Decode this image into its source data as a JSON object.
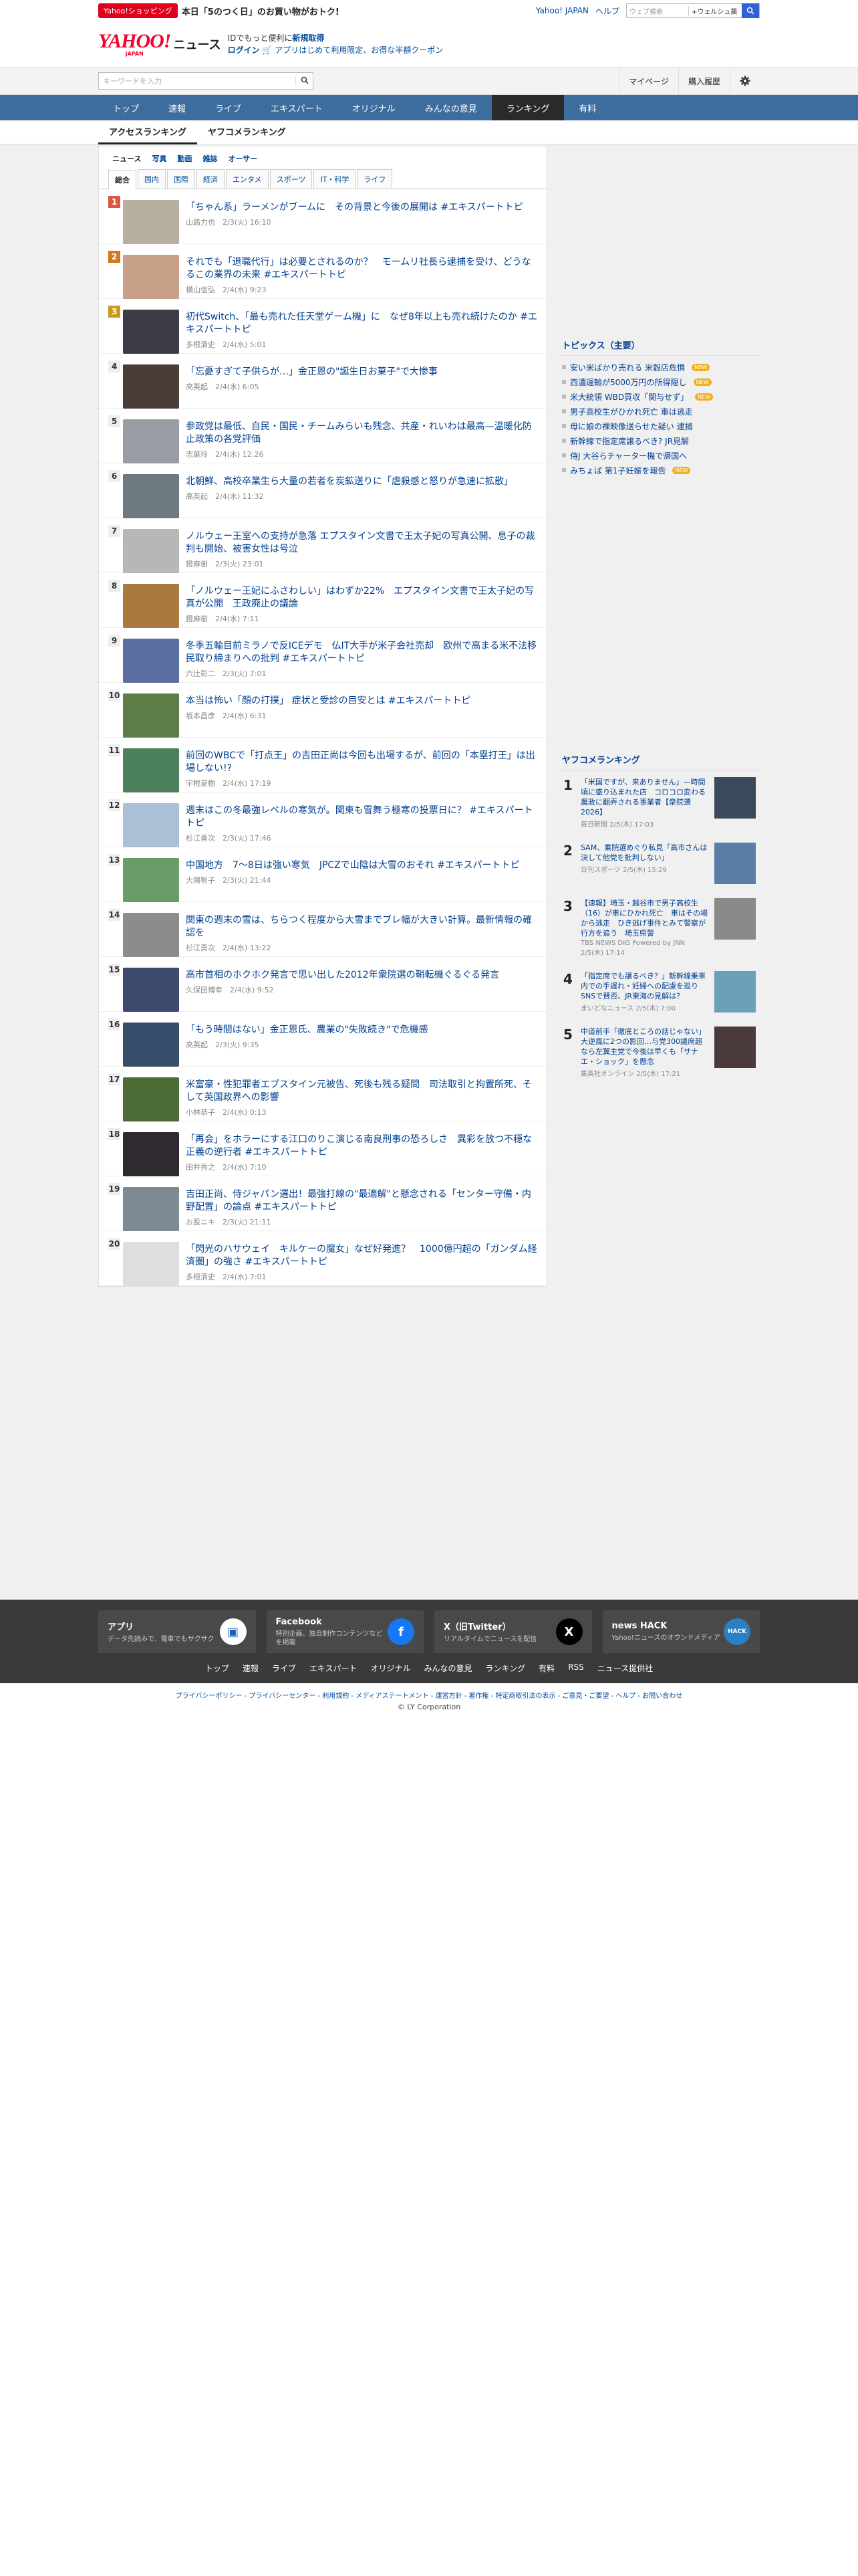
{
  "top": {
    "promo_badge": "Yahoo!ショッピング",
    "promo_text": "本日「5のつく日」のお買い物がおトク!",
    "links": [
      "Yahoo! JAPAN",
      "ヘルプ"
    ],
    "web_search_placeholder": "ウェブ検索",
    "web_search_option": "+ウェルシュ薬",
    "search_icon": "search-icon"
  },
  "header": {
    "logo_text": "YAHOO!",
    "logo_sub": "JAPAN",
    "logo_section": "ニュース",
    "line1_a": "IDでもっと便利に",
    "line1_b": "新規取得",
    "line2_a": "ログイン",
    "line2_b": "アプリはじめて利用限定、お得な半額クーポン"
  },
  "search": {
    "placeholder": "キーワードを入力",
    "mypage": "マイページ",
    "history": "購入履歴",
    "settings_icon": "gear-icon"
  },
  "nav": [
    "トップ",
    "速報",
    "ライブ",
    "エキスパート",
    "オリジナル",
    "みんなの意見",
    "ランキング",
    "有料"
  ],
  "nav_active": "ランキング",
  "subnav": [
    "アクセスランキング",
    "ヤフコメランキング"
  ],
  "categories": [
    "ニュース",
    "写真",
    "動画",
    "雑誌",
    "オーサー"
  ],
  "tabs": [
    "総合",
    "国内",
    "国際",
    "経済",
    "エンタメ",
    "スポーツ",
    "IT・科学",
    "ライフ"
  ],
  "ranking": [
    {
      "rank": "1",
      "title": "「ちゃん系」ラーメンがブームに　その背景と今後の展開は #エキスパートトピ",
      "meta": "山路力也　2/3(火) 16:10",
      "color": "#b7b0a0"
    },
    {
      "rank": "2",
      "title": "それでも「退職代行」は必要とされるのか？　モームリ社長ら逮捕を受け、どうなるこの業界の未来 #エキスパートトピ",
      "meta": "横山信弘　2/4(水) 9:23",
      "color": "#c8a08a"
    },
    {
      "rank": "3",
      "title": "初代Switch、「最も売れた任天堂ゲーム機」に　なぜ8年以上も売れ続けたのか #エキスパートトピ",
      "meta": "多根清史　2/4(水) 5:01",
      "color": "#3b3b46"
    },
    {
      "rank": "4",
      "title": "「忘憂すぎて子供らが…」金正恩の\"誕生日お菓子\"で大惨事",
      "meta": "高英起　2/4(水) 6:05",
      "color": "#4a3c36"
    },
    {
      "rank": "5",
      "title": "参政党は最低、自民・国民・チームみらいも残念、共産・れいわは最高—温暖化防止政策の各党評価",
      "meta": "志葉玲　2/4(水) 12:26",
      "color": "#9a9ea4"
    },
    {
      "rank": "6",
      "title": "北朝鮮、高校卒業生ら大量の若者を炭鉱送りに「虐殺感と怒りが急速に拡散」",
      "meta": "高英起　2/4(水) 11:32",
      "color": "#6f7a80"
    },
    {
      "rank": "7",
      "title": "ノルウェー王室への支持が急落 エプスタイン文書で王太子妃の写真公開、息子の裁判も開始、被害女性は号泣",
      "meta": "鐙麻樹　2/3(火) 23:01",
      "color": "#b6b8b6"
    },
    {
      "rank": "8",
      "title": "「ノルウェー王妃にふさわしい」はわずか22%　エプスタイン文書で王太子妃の写真が公開　王政廃止の議論",
      "meta": "鐙麻樹　2/4(水) 7:11",
      "color": "#a87a40"
    },
    {
      "rank": "9",
      "title": "冬季五輪目前ミラノで反ICEデモ　仏IT大手が米子会社売却　欧州で高まる米不法移民取り締まりへの批判 #エキスパートトピ",
      "meta": "六辻彰二　2/3(火) 7:01",
      "color": "#5a6fa0"
    },
    {
      "rank": "10",
      "title": "本当は怖い「顔の打撲」 症状と受診の目安とは #エキスパートトピ",
      "meta": "坂本昌彦　2/4(水) 6:31",
      "color": "#5e7c48"
    },
    {
      "rank": "11",
      "title": "前回のWBCで「打点王」の吉田正尚は今回も出場するが、前回の「本塁打王」は出場しない!?",
      "meta": "宇根夏樹　2/4(水) 17:19",
      "color": "#4c7f5b"
    },
    {
      "rank": "12",
      "title": "週末はこの冬最強レベルの寒気が。関東も雪舞う極寒の投票日に？ #エキスパートトピ",
      "meta": "杉江勇次　2/3(火) 17:46",
      "color": "#a9c0d6"
    },
    {
      "rank": "13",
      "title": "中国地方　7〜8日は強い寒気　JPCZで山陰は大雪のおそれ #エキスパートトピ",
      "meta": "大隅智子　2/3(火) 21:44",
      "color": "#6a9c6a"
    },
    {
      "rank": "14",
      "title": "関東の週末の雪は、ちらつく程度から大雪までブレ幅が大きい計算。最新情報の確認を",
      "meta": "杉江勇次　2/4(水) 13:22",
      "color": "#8c8c8c"
    },
    {
      "rank": "15",
      "title": "高市首相のホクホク発言で思い出した2012年衆院選の鞘転機ぐるぐる発言",
      "meta": "久保田博幸　2/4(水) 9:52",
      "color": "#3d4a6e"
    },
    {
      "rank": "16",
      "title": "「もう時間はない」金正恩氏、農業の\"失敗続き\"で危機感",
      "meta": "高英起　2/3(火) 9:35",
      "color": "#374e6a"
    },
    {
      "rank": "17",
      "title": "米富豪・性犯罪者エプスタイン元被告、死後も残る疑問　司法取引と拘置所死、そして英国政界への影響",
      "meta": "小林恭子　2/4(水) 0:13",
      "color": "#4d6b36"
    },
    {
      "rank": "18",
      "title": "「再会」をホラーにする江口のりこ演じる南良刑事の恐ろしさ　異彩を放つ不穏な正義の逆行者 #エキスパートトピ",
      "meta": "田井秀之　2/4(水) 7:10",
      "color": "#2e2a30"
    },
    {
      "rank": "19",
      "title": "吉田正尚、侍ジャパン選出！最強打線の\"最適解\"と懸念される「センター守備・内野配置」の論点 #エキスパートトピ",
      "meta": "お股ニキ　2/3(火) 21:11",
      "color": "#7d8a94"
    },
    {
      "rank": "20",
      "title": "「閃光のハサウェイ　キルケーの魔女」なぜ好発進？　1000億円超の「ガンダム経済圏」の強さ #エキスパートトピ",
      "meta": "多根清史　2/4(水) 7:01",
      "color": "#dedede"
    }
  ],
  "topics": {
    "title": "トピックス（主要）",
    "items": [
      {
        "text": "安い米ばかり売れる 米穀店危惧",
        "new": true
      },
      {
        "text": "西濃運輸が5000万円の所得隠し",
        "new": true
      },
      {
        "text": "米大統領 WBD買収「関与せず」",
        "new": true
      },
      {
        "text": "男子高校生がひかれ死亡 車は逃走",
        "new": false
      },
      {
        "text": "母に娘の裸映像送らせた疑い 逮捕",
        "new": false
      },
      {
        "text": "新幹線で指定席譲るべき? JR見解",
        "new": false
      },
      {
        "text": "侍J 大谷らチャーター機で帰国へ",
        "new": false
      },
      {
        "text": "みちょぱ 第1子妊娠を報告",
        "new": true
      }
    ],
    "new_label": "NEW"
  },
  "comment_ranking": {
    "title": "ヤフコメランキング",
    "items": [
      {
        "rank": "1",
        "title": "「米国ですが、来ありません」—時間頃に盛り込まれた店　コロコロ変わる農政に翻弄される事業者【衆院選2026】",
        "meta": "毎日新聞 2/5(木) 17:03",
        "color": "#3a4a5a"
      },
      {
        "rank": "2",
        "title": "SAM、乗院選めぐり私見「高市さんは決して他党を批判しない」",
        "meta": "日刊スポーツ 2/5(木) 15:29",
        "color": "#5a7ea8"
      },
      {
        "rank": "3",
        "title": "【速報】埼玉・越谷市で男子高校生（16）が車にひかれ死亡　車はその場から逃走　ひき逃げ事件とみて警察が行方を追う　埼玉県警",
        "meta": "TBS NEWS DIG Powered by JNN 2/5(木) 17:14",
        "color": "#8a8a8a"
      },
      {
        "rank": "4",
        "title": "「指定席でも譲るべき？」新幹線乗車内での手遅れ・妊婦への配慮を巡りSNSで賛否、JR東海の見解は？",
        "meta": "まいどなニュース 2/5(木) 7:00",
        "color": "#6aa0b8"
      },
      {
        "rank": "5",
        "title": "中道前手「徹底ところの話じゃない」大逆風に2つの影回…与党300議席超なら左翼主党で今後は早くも「サナエ・ショック」を懸念",
        "meta": "集英社オンライン 2/5(木) 17:21",
        "color": "#4a3a3a"
      }
    ]
  },
  "footer": {
    "cards": [
      {
        "title": "アプリ",
        "desc": "データ先読みで、電車でもサクサク",
        "icon": "app-icon"
      },
      {
        "title": "Facebook",
        "desc": "特別企画、独自制作コンテンツなどを掲載",
        "icon": "facebook-icon"
      },
      {
        "title": "X（旧Twitter）",
        "desc": "リアルタイムでニュースを配信",
        "icon": "x-icon"
      },
      {
        "title": "news HACK",
        "desc": "Yahoo!ニュースのオウンドメディア",
        "icon": "newshack-icon"
      }
    ],
    "links": [
      "トップ",
      "速報",
      "ライブ",
      "エキスパート",
      "オリジナル",
      "みんなの意見",
      "ランキング",
      "有料",
      "RSS",
      "ニュース提供社"
    ],
    "bottom": "プライバシーポリシー - プライバシーセンター - 利用規約 - メディアステートメント - 運営方針 - 著作権 - 特定商取引法の表示 - ご意見・ご要望 - ヘルプ - お問い合わせ",
    "copyright": "© LY Corporation"
  }
}
